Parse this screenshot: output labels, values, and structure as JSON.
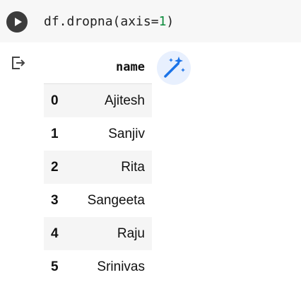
{
  "cell": {
    "code_prefix": "df.dropna(axis=",
    "code_arg": "1",
    "code_suffix": ")",
    "run_icon": "play-icon"
  },
  "output": {
    "output_icon": "output-redirect-icon",
    "suggest_icon": "magic-wand-icon",
    "table": {
      "columns": [
        "",
        "name"
      ],
      "rows": [
        {
          "index": "0",
          "name": "Ajitesh"
        },
        {
          "index": "1",
          "name": "Sanjiv"
        },
        {
          "index": "2",
          "name": "Rita"
        },
        {
          "index": "3",
          "name": "Sangeeta"
        },
        {
          "index": "4",
          "name": "Raju"
        },
        {
          "index": "5",
          "name": "Srinivas"
        }
      ]
    }
  },
  "colors": {
    "cell_background": "#f7f7f7",
    "run_button": "#3c3c3c",
    "code_number": "#0a8a3a",
    "row_stripe": "#f5f5f5",
    "magic_button_bg": "#e8f0fe",
    "magic_icon": "#1a73e8"
  }
}
